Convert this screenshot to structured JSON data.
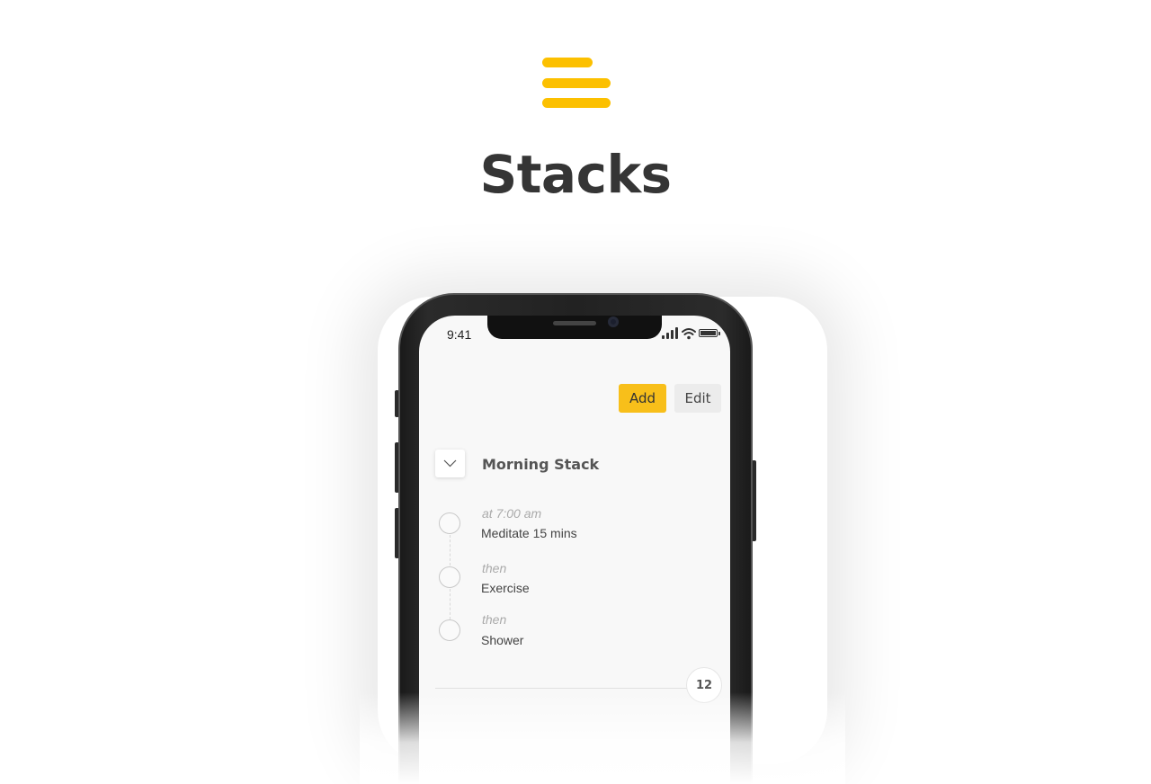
{
  "brand": {
    "title": "Stacks",
    "accent": "#fcc000",
    "icon": "stacks-logo-icon"
  },
  "status_bar": {
    "time": "9:41",
    "icons": [
      "signal-icon",
      "wifi-icon",
      "battery-icon"
    ]
  },
  "toolbar": {
    "add_label": "Add",
    "edit_label": "Edit"
  },
  "stack": {
    "title": "Morning Stack",
    "collapse_icon": "chevron-down-icon",
    "steps": [
      {
        "cue": "at 7:00 am",
        "name": "Meditate 15 mins"
      },
      {
        "cue": "then",
        "name": "Exercise"
      },
      {
        "cue": "then",
        "name": "Shower"
      }
    ],
    "count": "12"
  }
}
